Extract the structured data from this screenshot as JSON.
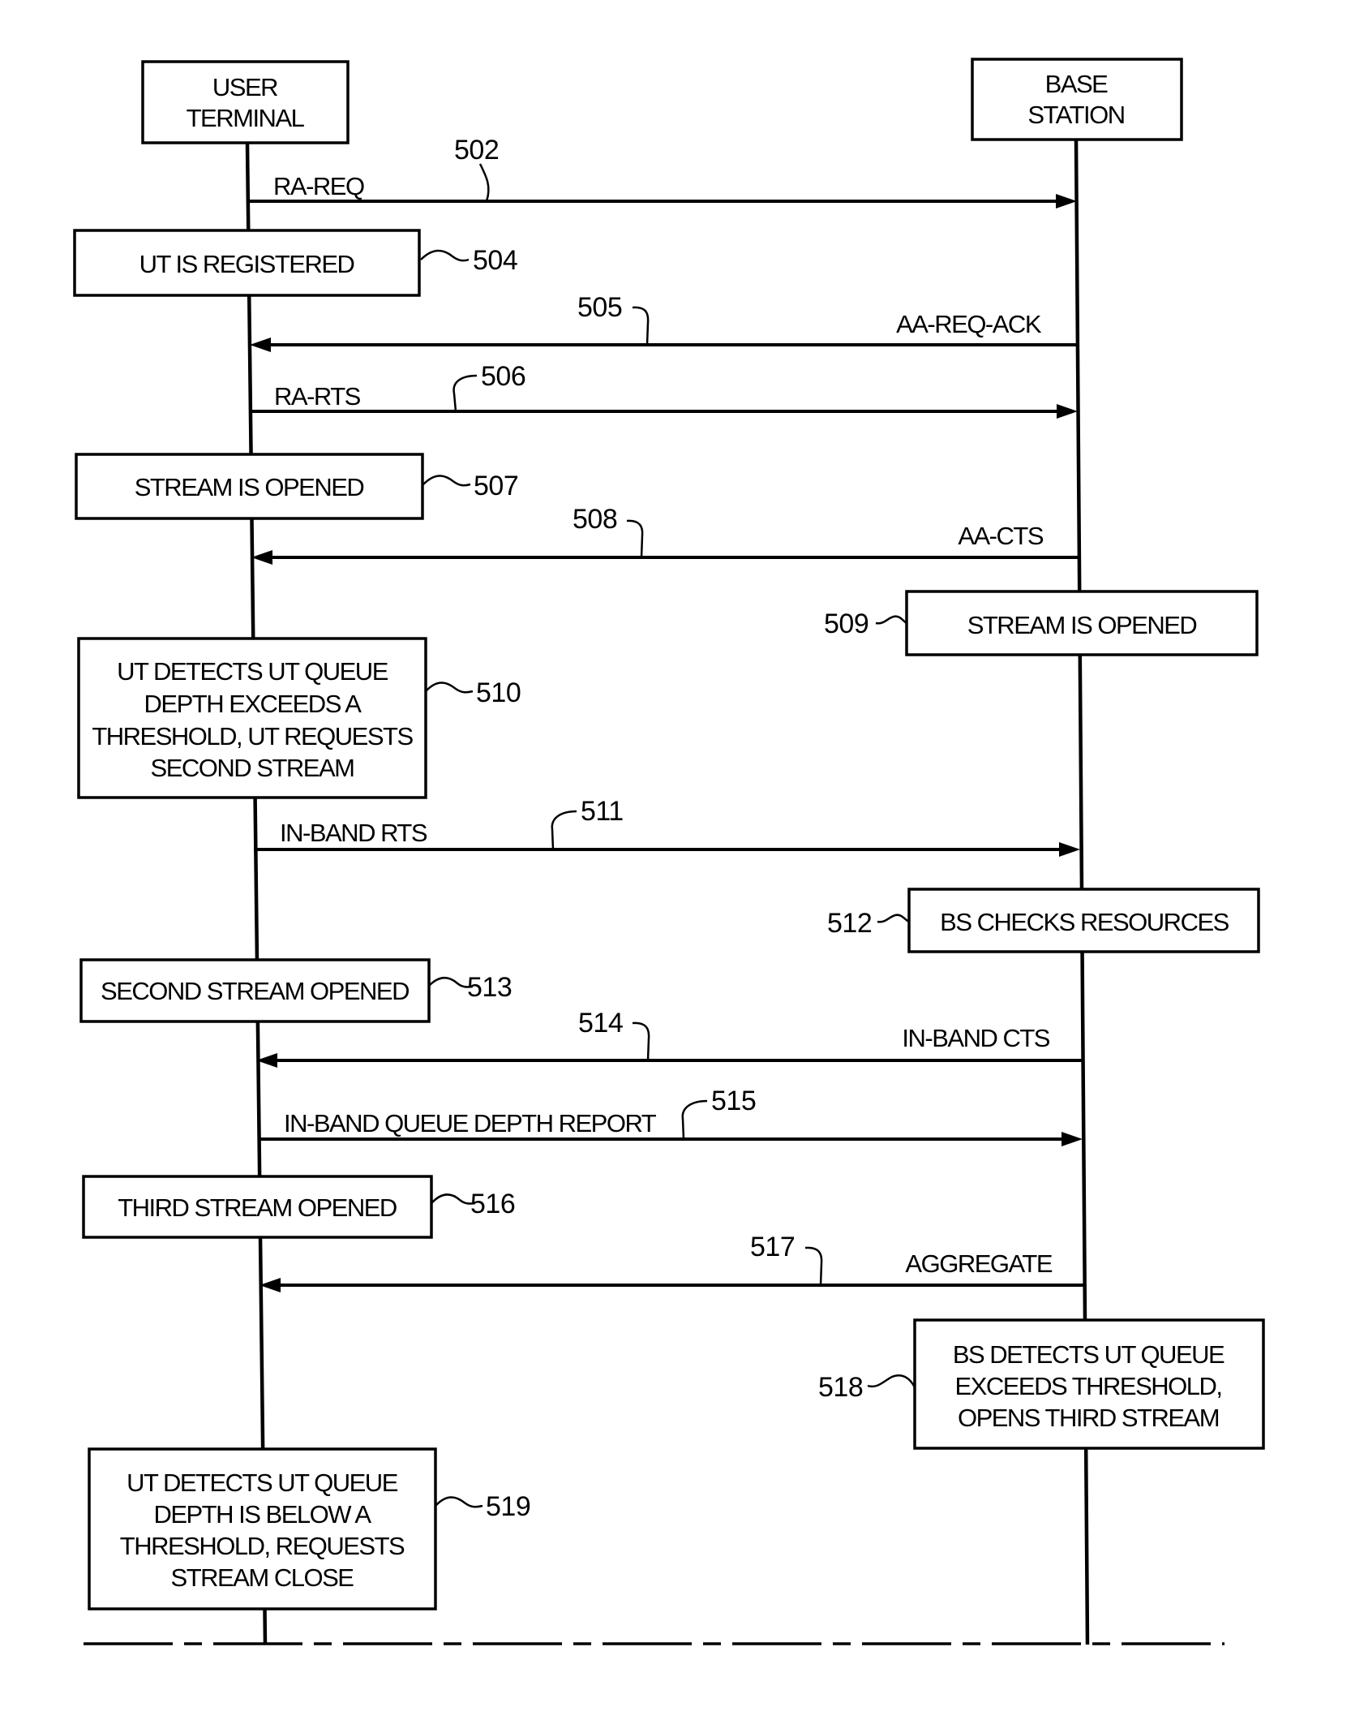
{
  "participants": {
    "user_terminal": {
      "lines": [
        "USER",
        "TERMINAL"
      ]
    },
    "base_station": {
      "lines": [
        "BASE",
        "STATION"
      ]
    }
  },
  "steps": [
    {
      "ref": "502",
      "kind": "message",
      "direction": "ut-to-bs",
      "label": "RA-REQ"
    },
    {
      "ref": "504",
      "kind": "action",
      "actor": "user_terminal",
      "lines": [
        "UT IS REGISTERED"
      ]
    },
    {
      "ref": "505",
      "kind": "message",
      "direction": "bs-to-ut",
      "label": "AA-REQ-ACK"
    },
    {
      "ref": "506",
      "kind": "message",
      "direction": "ut-to-bs",
      "label": "RA-RTS"
    },
    {
      "ref": "507",
      "kind": "action",
      "actor": "user_terminal",
      "lines": [
        "STREAM IS OPENED"
      ]
    },
    {
      "ref": "508",
      "kind": "message",
      "direction": "bs-to-ut",
      "label": "AA-CTS"
    },
    {
      "ref": "509",
      "kind": "action",
      "actor": "base_station",
      "lines": [
        "STREAM IS OPENED"
      ]
    },
    {
      "ref": "510",
      "kind": "action",
      "actor": "user_terminal",
      "lines": [
        "UT DETECTS UT QUEUE",
        "DEPTH EXCEEDS A",
        "THRESHOLD, UT REQUESTS",
        "SECOND STREAM"
      ]
    },
    {
      "ref": "511",
      "kind": "message",
      "direction": "ut-to-bs",
      "label": "IN-BAND RTS"
    },
    {
      "ref": "512",
      "kind": "action",
      "actor": "base_station",
      "lines": [
        "BS CHECKS RESOURCES"
      ]
    },
    {
      "ref": "513",
      "kind": "action",
      "actor": "user_terminal",
      "lines": [
        "SECOND STREAM OPENED"
      ]
    },
    {
      "ref": "514",
      "kind": "message",
      "direction": "bs-to-ut",
      "label": "IN-BAND CTS"
    },
    {
      "ref": "515",
      "kind": "message",
      "direction": "ut-to-bs",
      "label": "IN-BAND QUEUE DEPTH REPORT"
    },
    {
      "ref": "516",
      "kind": "action",
      "actor": "user_terminal",
      "lines": [
        "THIRD STREAM OPENED"
      ]
    },
    {
      "ref": "517",
      "kind": "message",
      "direction": "bs-to-ut",
      "label": "AGGREGATE"
    },
    {
      "ref": "518",
      "kind": "action",
      "actor": "base_station",
      "lines": [
        "BS DETECTS UT QUEUE",
        "EXCEEDS THRESHOLD,",
        "OPENS THIRD STREAM"
      ]
    },
    {
      "ref": "519",
      "kind": "action",
      "actor": "user_terminal",
      "lines": [
        "UT DETECTS UT QUEUE",
        "DEPTH IS BELOW A",
        "THRESHOLD, REQUESTS",
        "STREAM CLOSE"
      ]
    }
  ]
}
